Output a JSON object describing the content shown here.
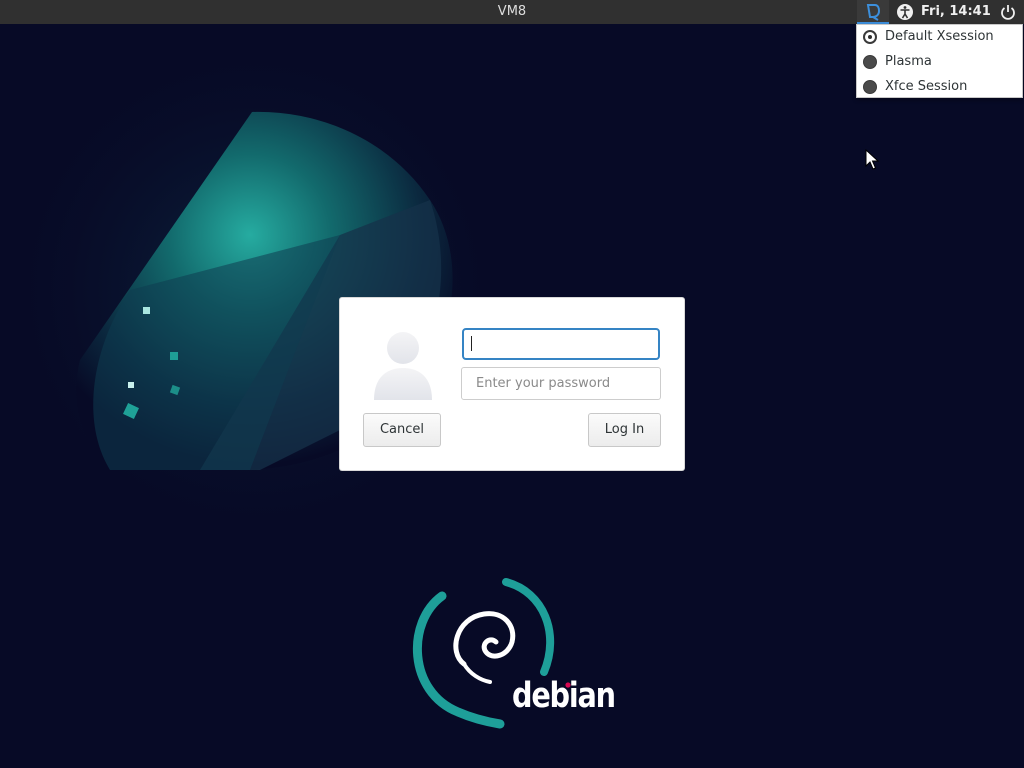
{
  "panel": {
    "hostname": "VM8",
    "clock": "Fri, 14:41",
    "icons": [
      "session-icon",
      "accessibility-icon",
      "power-icon"
    ]
  },
  "session_menu": {
    "items": [
      {
        "label": "Default Xsession",
        "selected": true
      },
      {
        "label": "Plasma",
        "selected": false
      },
      {
        "label": "Xfce Session",
        "selected": false
      }
    ]
  },
  "login": {
    "username_value": "",
    "password_placeholder": "Enter your password",
    "cancel_label": "Cancel",
    "login_label": "Log In"
  },
  "branding": {
    "wordmark": "debian",
    "accent": "#1e9f99",
    "brand_dot": "#d70751"
  },
  "colors": {
    "background": "#070a26",
    "panel": "#303030",
    "focus": "#3584c4"
  }
}
